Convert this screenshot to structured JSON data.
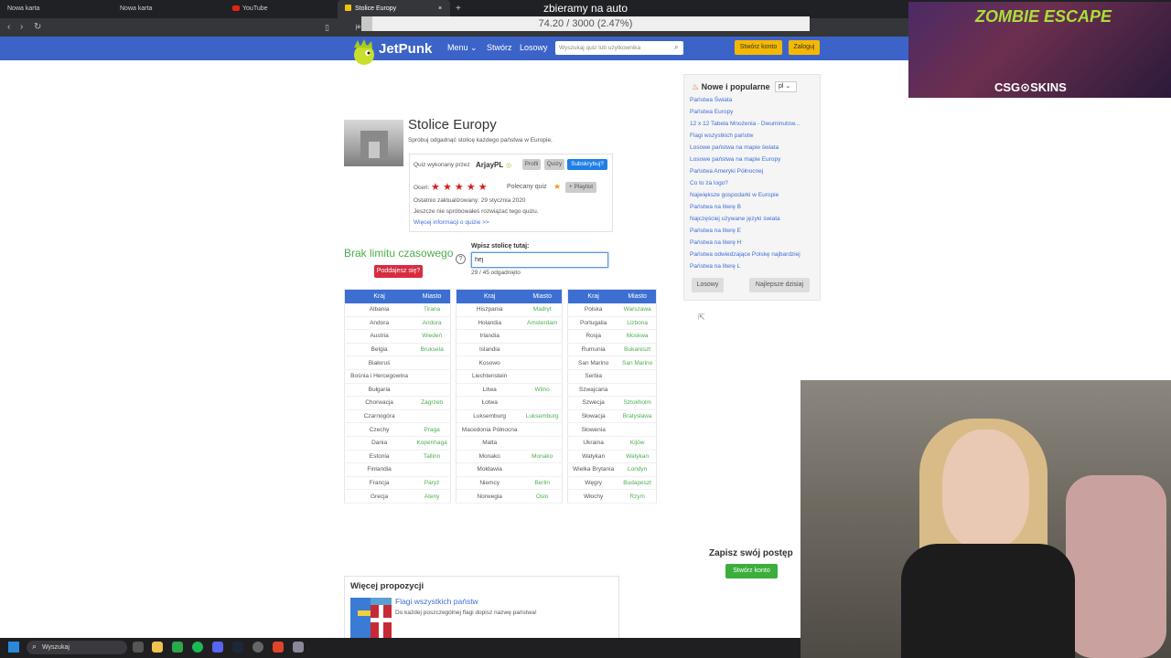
{
  "browser": {
    "tabs": [
      {
        "label": "Nowa karta"
      },
      {
        "label": "Nowa karta"
      },
      {
        "label": "YouTube"
      },
      {
        "label": "Stolice Europy",
        "active": true
      }
    ],
    "new_tab_symbol": "+",
    "address_partial": "je",
    "nav": {
      "back": "‹",
      "forward": "›",
      "reload": "↻",
      "close": "×"
    }
  },
  "stream": {
    "title": "zbieramy na auto",
    "progress_text": "74.20 / 3000 (2.47%)",
    "progress_value": 0.0247
  },
  "site": {
    "logo": "JetPunk",
    "nav": {
      "menu": "Menu",
      "create": "Stwórz",
      "random": "Losowy"
    },
    "search_placeholder": "Wyszukaj quiz lub użytkownika",
    "create_account": "Stwórz konto",
    "login": "Zaloguj",
    "header_color": "#3c64c8",
    "accent_color": "#f5b800"
  },
  "quiz": {
    "title": "Stolice Europy",
    "description": "Spróbuj odgadnąć stolicę każdego państwa w Europie.",
    "made_by_label": "Quiz wykonany przez",
    "author": "ArjayPL",
    "profile_btn": "Profil",
    "quizzes_btn": "Quizy",
    "subscribe_btn": "Subskrybuj?",
    "rate_label": "Oceń:",
    "rating_stars": 5,
    "recommended_label": "Polecany quiz",
    "playlist_btn": "+ Playlist",
    "updated": "Ostatnio zaktualizowany: 29 stycznia 2020",
    "not_tried": "Jeszcze nie spróbowałeś rozwiązać tego quizu.",
    "more_info": "Więcej informacji o quizie >>",
    "time_limit": "Brak limitu czasowego",
    "give_up": "Poddajesz się?",
    "help": "?",
    "answer_label": "Wpisz stolicę tutaj:",
    "answer_value": "hej",
    "counter": "29 / 45 odgadnięto"
  },
  "tables": {
    "headers": {
      "country": "Kraj",
      "capital": "Miasto"
    },
    "col1": [
      [
        "Albania",
        "Tirana"
      ],
      [
        "Andora",
        "Andora"
      ],
      [
        "Austria",
        "Wiedeń"
      ],
      [
        "Belgia",
        "Bruksela"
      ],
      [
        "Białoruś",
        ""
      ],
      [
        "Bośnia i Hercegowina",
        ""
      ],
      [
        "Bułgaria",
        ""
      ],
      [
        "Chorwacja",
        "Zagrzeb"
      ],
      [
        "Czarnogóra",
        ""
      ],
      [
        "Czechy",
        "Praga"
      ],
      [
        "Dania",
        "Kopenhaga"
      ],
      [
        "Estonia",
        "Tallinn"
      ],
      [
        "Finlandia",
        ""
      ],
      [
        "Francja",
        "Paryż"
      ],
      [
        "Grecja",
        "Ateny"
      ]
    ],
    "col2": [
      [
        "Hiszpania",
        "Madryt"
      ],
      [
        "Holandia",
        "Amsterdam"
      ],
      [
        "Irlandia",
        ""
      ],
      [
        "Islandia",
        ""
      ],
      [
        "Kosowo",
        ""
      ],
      [
        "Liechtenstein",
        ""
      ],
      [
        "Litwa",
        "Wilno"
      ],
      [
        "Łotwa",
        ""
      ],
      [
        "Luksemburg",
        "Luksemburg"
      ],
      [
        "Macedonia Północna",
        ""
      ],
      [
        "Malta",
        ""
      ],
      [
        "Monako",
        "Monako"
      ],
      [
        "Mołdawia",
        ""
      ],
      [
        "Niemcy",
        "Berlin"
      ],
      [
        "Norwegia",
        "Oslo"
      ]
    ],
    "col3": [
      [
        "Polska",
        "Warszawa"
      ],
      [
        "Portugalia",
        "Lizbona"
      ],
      [
        "Rosja",
        "Moskwa"
      ],
      [
        "Rumunia",
        "Bukareszt"
      ],
      [
        "San Marino",
        "San Marino"
      ],
      [
        "Serbia",
        ""
      ],
      [
        "Szwajcaria",
        ""
      ],
      [
        "Szwecja",
        "Sztokholm"
      ],
      [
        "Słowacja",
        "Bratysława"
      ],
      [
        "Słowenia",
        ""
      ],
      [
        "Ukraina",
        "Kijów"
      ],
      [
        "Watykan",
        "Watykan"
      ],
      [
        "Wielka Brytania",
        "Londyn"
      ],
      [
        "Węgry",
        "Budapeszt"
      ],
      [
        "Włochy",
        "Rzym"
      ]
    ]
  },
  "sidebar": {
    "title": "Nowe i popularne",
    "lang": "pl",
    "items": [
      "Państwa Świata",
      "Państwa Europy",
      "12 x 12 Tabela Mnożenia - Dwuminutow...",
      "Flagi wszystkich państw",
      "Losowe państwa na mapie świata",
      "Losowe państwa na mapie Europy",
      "Państwa Ameryki Północnej",
      "Co to za logo?",
      "Największe gospodarki w Europie",
      "Państwa na literę B",
      "Najczęściej używane języki świata",
      "Państwa na literę E",
      "Państwa na literę H",
      "Państwa odwiedzające Polskę najbardziej",
      "Państwa na literę L"
    ],
    "random_btn": "Losowy",
    "best_today_btn": "Najlepsze dzisiaj"
  },
  "save": {
    "title": "Zapisz swój postęp",
    "button": "Stwórz konto"
  },
  "more": {
    "title": "Więcej propozycji",
    "link": "Flagi wszystkich państw",
    "desc": "Do każdej poszczególnej flagi dopisz nazwę państwa!"
  },
  "taskbar": {
    "search": "Wyszukaj"
  },
  "ad": {
    "title": "ZOMBIE ESCAPE",
    "sub": "CSG⊙SKINS"
  }
}
